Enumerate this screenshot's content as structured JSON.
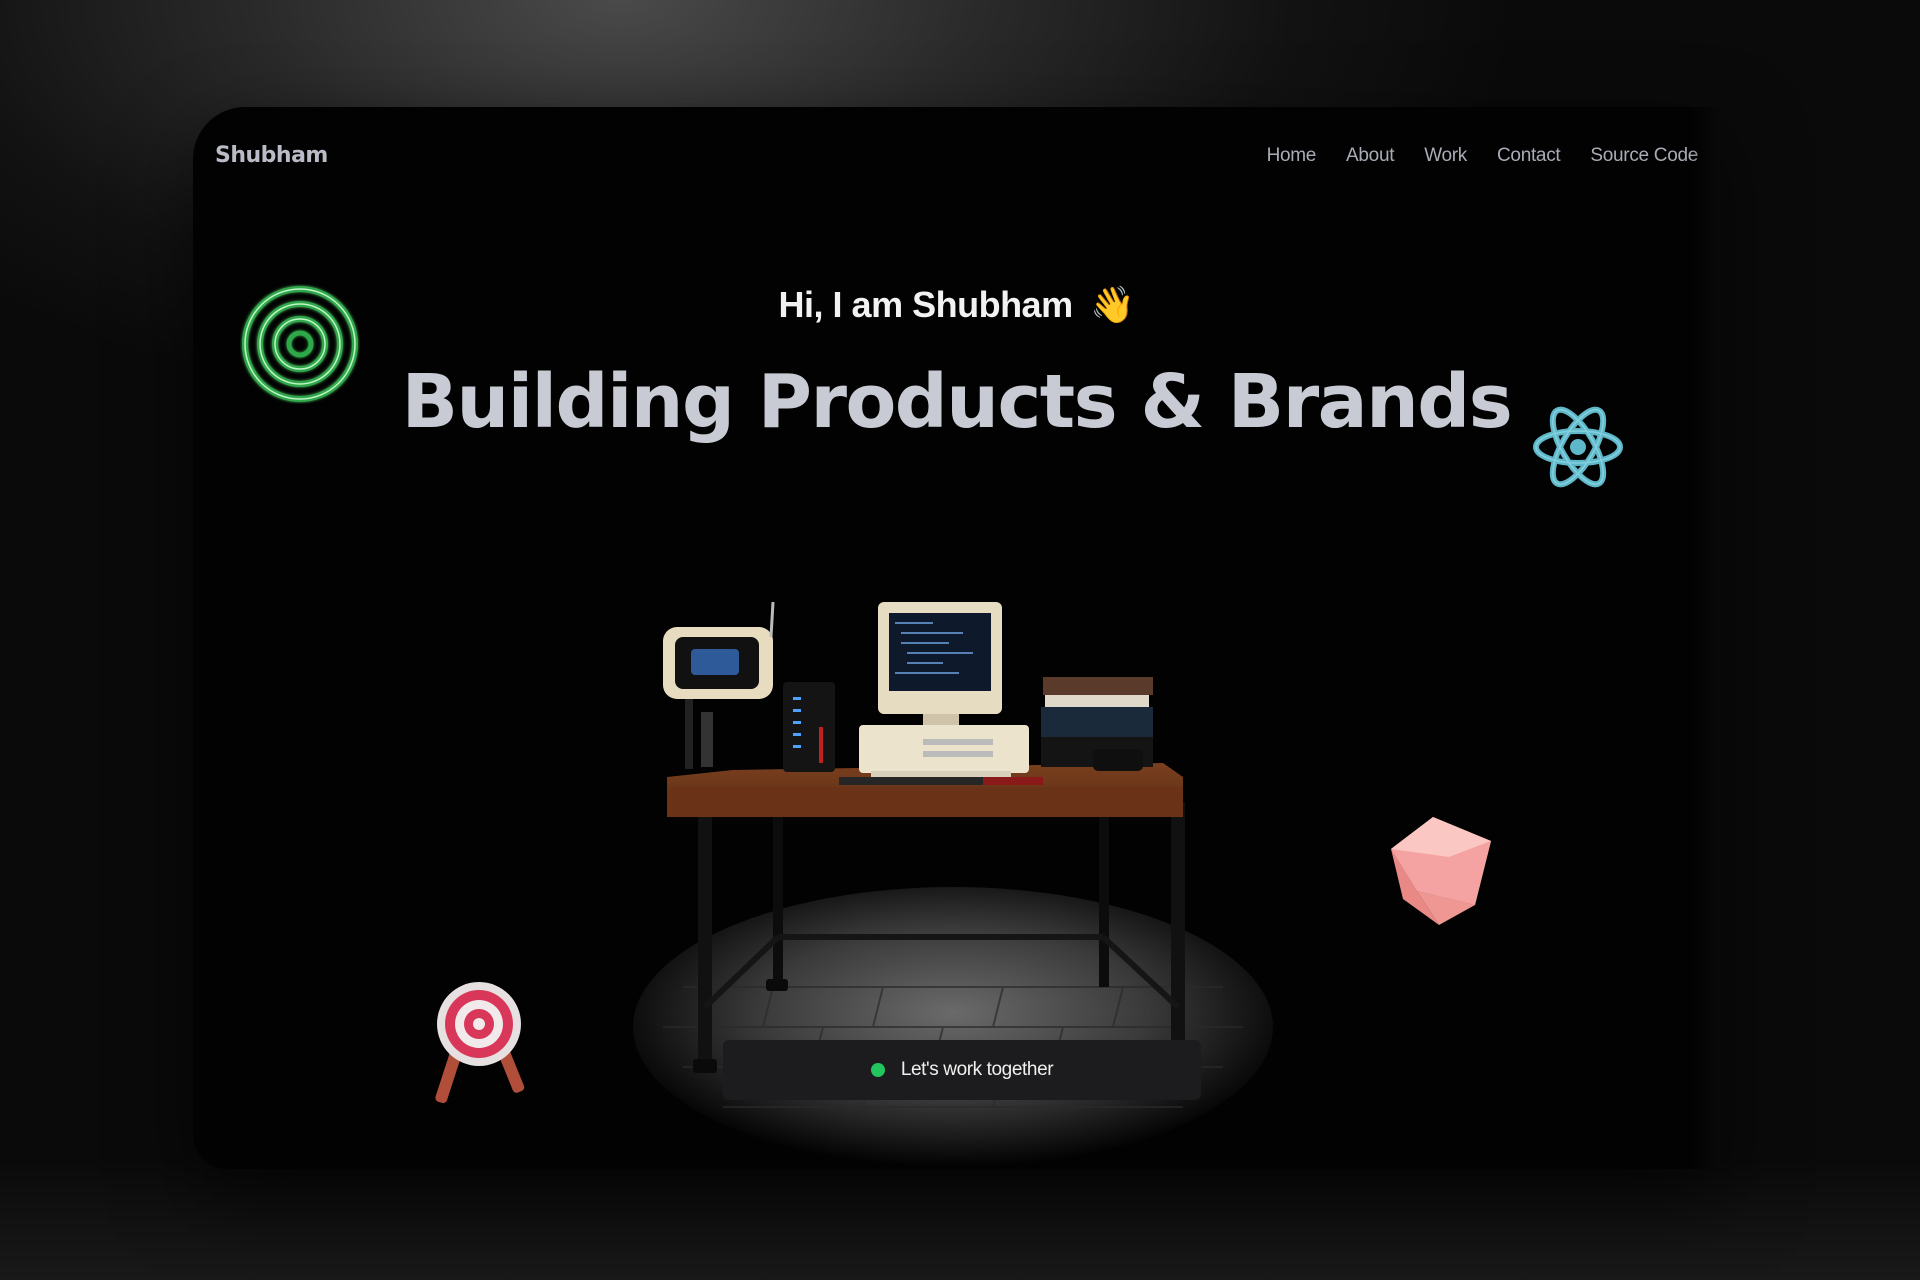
{
  "brand": {
    "name": "Shubham"
  },
  "nav": {
    "items": [
      {
        "label": "Home"
      },
      {
        "label": "About"
      },
      {
        "label": "Work"
      },
      {
        "label": "Contact"
      },
      {
        "label": "Source Code"
      }
    ]
  },
  "hero": {
    "greeting": "Hi, I am Shubham",
    "greeting_emoji": "👋",
    "headline": "Building Products & Brands",
    "cta_label": "Let's work together"
  },
  "decorations": {
    "rings_icon": "green-concentric-rings-icon",
    "react_icon": "react-atom-icon",
    "cube_icon": "pink-cube-icon",
    "target_icon": "archery-target-icon",
    "desk_scene": "3d-retro-computer-desk"
  },
  "colors": {
    "accent_green": "#22c55e",
    "react_cyan": "#5fb8c9",
    "cube_pink": "#f4a1a0",
    "target_red": "#d8375a"
  }
}
